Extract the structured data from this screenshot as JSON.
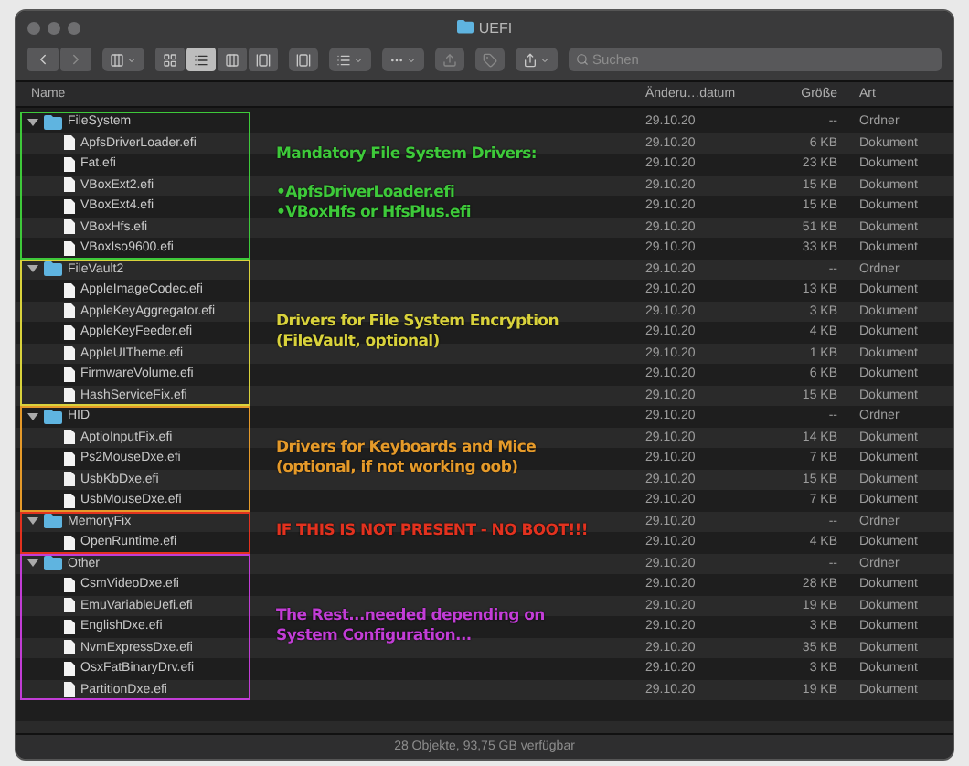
{
  "window": {
    "title": "UEFI"
  },
  "toolbar": {
    "view_modes": [
      {
        "selected": false
      },
      {
        "selected": true
      },
      {
        "selected": false
      },
      {
        "selected": false
      }
    ],
    "search": {
      "placeholder": "Suchen"
    }
  },
  "columns": [
    "Name",
    "Änderu…datum",
    "Größe",
    "Art"
  ],
  "groups": [
    {
      "color": "#3ec93a",
      "note": [
        "Mandatory File System Drivers:",
        "•ApfsDriverLoader.efi\n•VBoxHfs or HfsPlus.efi"
      ],
      "folder": {
        "kind": "folder",
        "name": "FileSystem",
        "expanded": true,
        "date": "29.10.20",
        "size": "--",
        "type": "Ordner",
        "children": [
          {
            "kind": "file",
            "name": "ApfsDriverLoader.efi",
            "date": "29.10.20",
            "size": "6 KB",
            "type": "Dokument"
          },
          {
            "kind": "file",
            "name": "Fat.efi",
            "date": "29.10.20",
            "size": "23 KB",
            "type": "Dokument"
          },
          {
            "kind": "file",
            "name": "VBoxExt2.efi",
            "date": "29.10.20",
            "size": "15 KB",
            "type": "Dokument"
          },
          {
            "kind": "file",
            "name": "VBoxExt4.efi",
            "date": "29.10.20",
            "size": "15 KB",
            "type": "Dokument"
          },
          {
            "kind": "file",
            "name": "VBoxHfs.efi",
            "date": "29.10.20",
            "size": "51 KB",
            "type": "Dokument"
          },
          {
            "kind": "file",
            "name": "VBoxIso9600.efi",
            "date": "29.10.20",
            "size": "33 KB",
            "type": "Dokument"
          }
        ]
      }
    },
    {
      "color": "#d9d23c",
      "note": [
        "Drivers for File System Encryption\n(FileVault, optional)"
      ],
      "folder": {
        "kind": "folder",
        "name": "FileVault2",
        "expanded": true,
        "date": "29.10.20",
        "size": "--",
        "type": "Ordner",
        "children": [
          {
            "kind": "file",
            "name": "AppleImageCodec.efi",
            "date": "29.10.20",
            "size": "13 KB",
            "type": "Dokument"
          },
          {
            "kind": "file",
            "name": "AppleKeyAggregator.efi",
            "date": "29.10.20",
            "size": "3 KB",
            "type": "Dokument"
          },
          {
            "kind": "file",
            "name": "AppleKeyFeeder.efi",
            "date": "29.10.20",
            "size": "4 KB",
            "type": "Dokument"
          },
          {
            "kind": "file",
            "name": "AppleUITheme.efi",
            "date": "29.10.20",
            "size": "1 KB",
            "type": "Dokument"
          },
          {
            "kind": "file",
            "name": "FirmwareVolume.efi",
            "date": "29.10.20",
            "size": "6 KB",
            "type": "Dokument"
          },
          {
            "kind": "file",
            "name": "HashServiceFix.efi",
            "date": "29.10.20",
            "size": "15 KB",
            "type": "Dokument"
          }
        ]
      }
    },
    {
      "color": "#e59a2a",
      "note": [
        "Drivers for Keyboards and Mice\n(optional, if not working oob)"
      ],
      "folder": {
        "kind": "folder",
        "name": "HID",
        "expanded": true,
        "date": "29.10.20",
        "size": "--",
        "type": "Ordner",
        "children": [
          {
            "kind": "file",
            "name": "AptioInputFix.efi",
            "date": "29.10.20",
            "size": "14 KB",
            "type": "Dokument"
          },
          {
            "kind": "file",
            "name": "Ps2MouseDxe.efi",
            "date": "29.10.20",
            "size": "7 KB",
            "type": "Dokument"
          },
          {
            "kind": "file",
            "name": "UsbKbDxe.efi",
            "date": "29.10.20",
            "size": "15 KB",
            "type": "Dokument"
          },
          {
            "kind": "file",
            "name": "UsbMouseDxe.efi",
            "date": "29.10.20",
            "size": "7 KB",
            "type": "Dokument"
          }
        ]
      }
    },
    {
      "color": "#e2321f",
      "note": [
        "IF THIS IS NOT PRESENT - NO BOOT!!!"
      ],
      "folder": {
        "kind": "folder",
        "name": "MemoryFix",
        "expanded": true,
        "date": "29.10.20",
        "size": "--",
        "type": "Ordner",
        "children": [
          {
            "kind": "file",
            "name": "OpenRuntime.efi",
            "date": "29.10.20",
            "size": "4 KB",
            "type": "Dokument"
          }
        ]
      }
    },
    {
      "color": "#c23dd6",
      "note": [
        "The Rest...needed depending on\nSystem Configuration..."
      ],
      "folder": {
        "kind": "folder",
        "name": "Other",
        "expanded": true,
        "date": "29.10.20",
        "size": "--",
        "type": "Ordner",
        "children": [
          {
            "kind": "file",
            "name": "CsmVideoDxe.efi",
            "date": "29.10.20",
            "size": "28 KB",
            "type": "Dokument"
          },
          {
            "kind": "file",
            "name": "EmuVariableUefi.efi",
            "date": "29.10.20",
            "size": "19 KB",
            "type": "Dokument"
          },
          {
            "kind": "file",
            "name": "EnglishDxe.efi",
            "date": "29.10.20",
            "size": "3 KB",
            "type": "Dokument"
          },
          {
            "kind": "file",
            "name": "NvmExpressDxe.efi",
            "date": "29.10.20",
            "size": "35 KB",
            "type": "Dokument"
          },
          {
            "kind": "file",
            "name": "OsxFatBinaryDrv.efi",
            "date": "29.10.20",
            "size": "3 KB",
            "type": "Dokument"
          },
          {
            "kind": "file",
            "name": "PartitionDxe.efi",
            "date": "29.10.20",
            "size": "19 KB",
            "type": "Dokument"
          }
        ]
      }
    }
  ],
  "status_bar": "28 Objekte, 93,75 GB verfügbar"
}
